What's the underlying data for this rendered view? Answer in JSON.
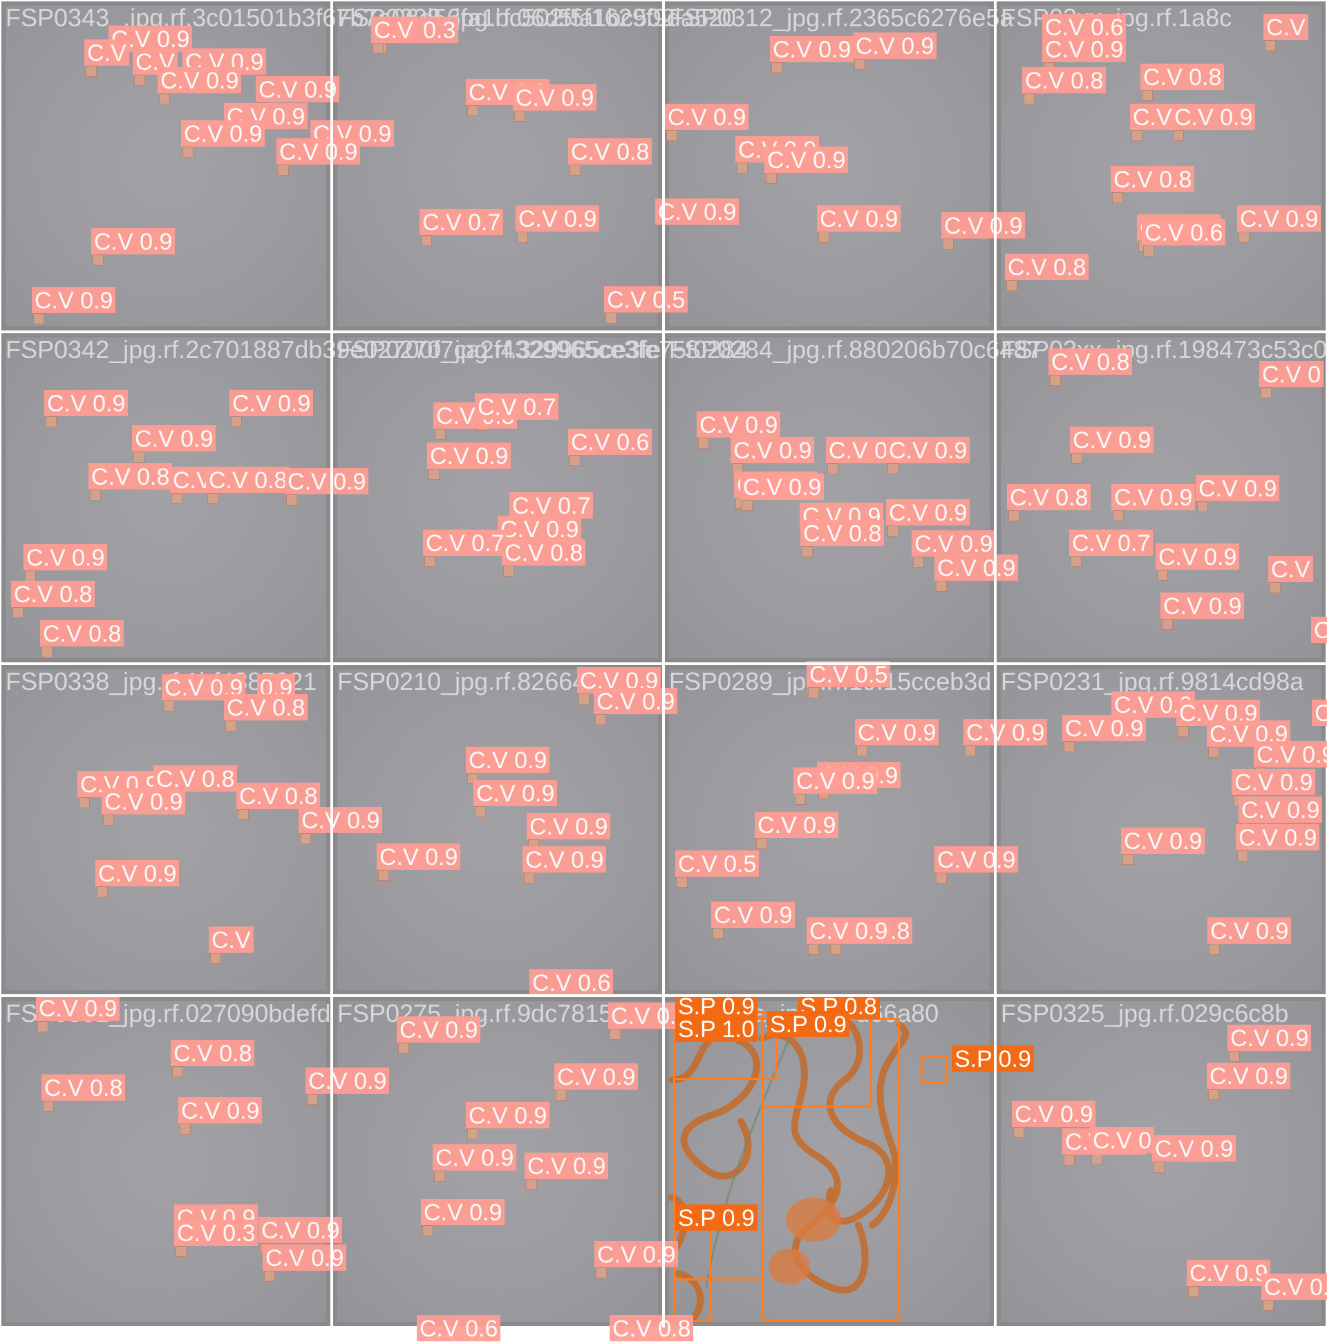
{
  "colors": {
    "cv_label": "#ff9e94",
    "sp_label": "#f26a14",
    "plate": "#9e9ea2",
    "frame": "#8a8a8d"
  },
  "tiles": [
    {
      "name": "FSP0343_.jpg.rf.3c01501b3f67b7a06d56fa1bc502f5f1629f9da520",
      "labels": [
        "C.V 0.9",
        "C.V",
        "C.V",
        "C.V 0.9",
        "C.V 0.9",
        "C.V 0.9",
        "C.V 0.9",
        "C.V 0.9",
        "C.V 0.9",
        "C.V 0.9",
        "C.V 0.9",
        "C.V 0.9"
      ]
    },
    {
      "name": "FSP0308_jpg.rf.06d5fa1bc502",
      "labels": [
        "C.V 0.3",
        "C.V",
        "C.V 0.8",
        "C.V 0.9",
        "C.V 0.8",
        "C.V 0.9",
        "C.V 0.9",
        "C.V 0.7",
        "C.V 0.5"
      ]
    },
    {
      "name": "FSP0312_jpg.rf.2365c6276e5a",
      "labels": [
        "C.V 0.9",
        "C.V 0.9",
        "C.V 0.9",
        "C.V 0.9",
        "C.V 0.9",
        "C.V 0.9",
        "C.V 0.9"
      ]
    },
    {
      "name": "FSP03xx_jpg.rf.1a8c",
      "labels": [
        "C.V 0.6",
        "C.V 0.9",
        "C.V 0.8",
        "C.V 0.8",
        "C.V",
        "C.V 0.9",
        "C.V 0.8",
        "C.V 0.9",
        "C.V 0.6",
        "C.V 0.9",
        "C.V 0.8",
        "C.V"
      ]
    },
    {
      "name": "FSP0342_jpg.rf.2c701887db39e02700f7ca2f4329965ce3fe75f0284",
      "labels": [
        "C.V 0.9",
        "C.V 0.9",
        "C.V 0.9",
        "C.V 0.8",
        "C.V",
        "C.V 0.8",
        "C.V 0.9",
        "C.V 0.9",
        "C.V 0.8",
        "C.V 0.8"
      ]
    },
    {
      "name": "FSP0270_jpg.rf.329965ce3fe",
      "labels": [
        "C.V 0.8",
        "C.V 0.7",
        "C.V 0.6",
        "C.V 0.9",
        "C.V 0.9",
        "C.V 0.7",
        "C.V 0.8",
        "C.V 0.7"
      ]
    },
    {
      "name": "FSP0284_jpg.rf.880206b70c6487",
      "labels": [
        "C.V 0.9",
        "C.V 0.9",
        "C.V 0.9",
        "C.V 0.9",
        "C.V 0.9",
        "C.V 0.9",
        "C.V 0.9",
        "C.V 0.8",
        "C.V 0.9",
        "C.V 0.9",
        "C.V 0.9"
      ]
    },
    {
      "name": "FSP03xx_jpg.rf.198473c53c0ce",
      "labels": [
        "C.V 0.8",
        "C.V 0",
        "C.V 0.9",
        "C.V 0.8",
        "C.V 0.9",
        "C.V 0.9",
        "C.V 0.7",
        "C.V 0.9",
        "C.V",
        "C.V 0.9",
        "C"
      ]
    },
    {
      "name": "FSP0338_jpg.rf.1bf4887021",
      "labels": [
        "C.V 0.9",
        "0.9",
        "C.V 0.8",
        "C.V 0.9",
        "C.V 0.9",
        "C.V 0.8",
        "C.V 0.8",
        "C.V 0.9",
        "C.V 0.9",
        "C.V"
      ]
    },
    {
      "name": "FSP0210_jpg.rf.82664f1",
      "labels": [
        "C.V 0.9",
        "C.V 0.9",
        "C.V 0.9",
        "C.V 0.9",
        "C.V 0.9",
        "C.V 0.9",
        "C.V 0.9",
        "C.V 0.6"
      ]
    },
    {
      "name": "FSP0289_jpg.rf.19f15cceb3d",
      "labels": [
        "C.V 0.5",
        "C.V 0.9",
        "C.V 0.9",
        "C.V 0.9",
        "C.V 0.9",
        "C.V 0.9",
        "C.V 0.5",
        "C.V 0.9",
        "C.V 0.9",
        "C.V 0.8",
        "C.V 0.9"
      ]
    },
    {
      "name": "FSP0231_jpg.rf.9814cd98a",
      "labels": [
        "C.V 0.9",
        "C.V 0.9",
        "C.V 0.9",
        "C.V 0.9",
        "C.V 0.9",
        "C.V 0.9",
        "C.V 0.9",
        "C.V 0.9",
        "C.V 0.9",
        "C.V 0.9",
        "C"
      ]
    },
    {
      "name": "FSP0301_jpg.rf.027090bdefd",
      "labels": [
        "C.V 0.9",
        "C.V 0.8",
        "C.V 0.8",
        "C.V 0.9",
        "C.V 0.9",
        "C.V 0.9",
        "C.V 0.3",
        "C.V 0.9",
        "C.V 0.9"
      ]
    },
    {
      "name": "FSP0275_jpg.rf.9dc781504",
      "labels": [
        "C.V 0.9",
        "C.V 0.9",
        "C.V 0.9",
        "C.V 0.9",
        "C.V 0.9",
        "C.V 0.9",
        "C.V 0.9",
        "C.V 0.9",
        "C.V 0.6",
        "C.V 0.8"
      ]
    },
    {
      "name": "Spirulina_jpg.rf.4d66a80",
      "labels": [
        "S.P 0.9",
        "S.P 0.8",
        "S.P 0.9",
        "S.P 1.0",
        "S.P 0.9",
        "S.P 0.9"
      ]
    },
    {
      "name": "FSP0325_jpg.rf.029c6c8b",
      "labels": [
        "C.V 0.9",
        "C.V 0.9",
        "C.V 0.9",
        "C.V 0.9",
        "C.V 0.9",
        "C.V 0.9",
        "C.V 0.9",
        "C.V 0"
      ]
    }
  ]
}
